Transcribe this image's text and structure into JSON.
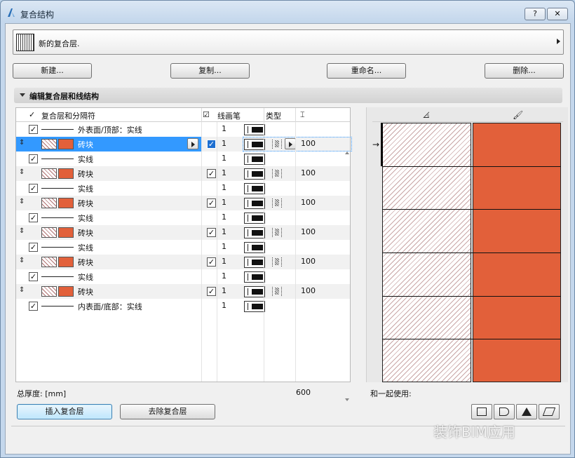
{
  "window": {
    "title": "复合结构",
    "help_label": "?",
    "close_label": "✕"
  },
  "profile": {
    "name": "新的复合层."
  },
  "toolbar": {
    "new_label": "新建...",
    "copy_label": "复制...",
    "rename_label": "重命名...",
    "delete_label": "删除..."
  },
  "section": {
    "title": "编辑复合层和线结构"
  },
  "table": {
    "columns": {
      "layer": "复合层和分隔符",
      "pen": "线画笔",
      "type": "类型"
    },
    "rows": [
      {
        "kind": "line",
        "name": "外表面/顶部：实线",
        "pen": "1"
      },
      {
        "kind": "skin",
        "name": "砖块",
        "pen": "1",
        "thickness": "100",
        "selected": true
      },
      {
        "kind": "line",
        "name": "实线",
        "pen": "1"
      },
      {
        "kind": "skin",
        "name": "砖块",
        "pen": "1",
        "thickness": "100"
      },
      {
        "kind": "line",
        "name": "实线",
        "pen": "1"
      },
      {
        "kind": "skin",
        "name": "砖块",
        "pen": "1",
        "thickness": "100"
      },
      {
        "kind": "line",
        "name": "实线",
        "pen": "1"
      },
      {
        "kind": "skin",
        "name": "砖块",
        "pen": "1",
        "thickness": "100"
      },
      {
        "kind": "line",
        "name": "实线",
        "pen": "1"
      },
      {
        "kind": "skin",
        "name": "砖块",
        "pen": "1",
        "thickness": "100"
      },
      {
        "kind": "line",
        "name": "实线",
        "pen": "1"
      },
      {
        "kind": "skin",
        "name": "砖块",
        "pen": "1",
        "thickness": "100"
      },
      {
        "kind": "line",
        "name": "内表面/底部：实线",
        "pen": "1"
      }
    ]
  },
  "total": {
    "label": "总厚度: [mm]",
    "value": "600"
  },
  "buttons": {
    "insert_label": "插入复合层",
    "remove_label": "去除复合层"
  },
  "preview": {
    "use_with_label": "和一起使用:",
    "hatch_color": "#c9a6a6",
    "fill_color": "#e2603a"
  },
  "watermark": {
    "text": "装饰BIM应用"
  }
}
